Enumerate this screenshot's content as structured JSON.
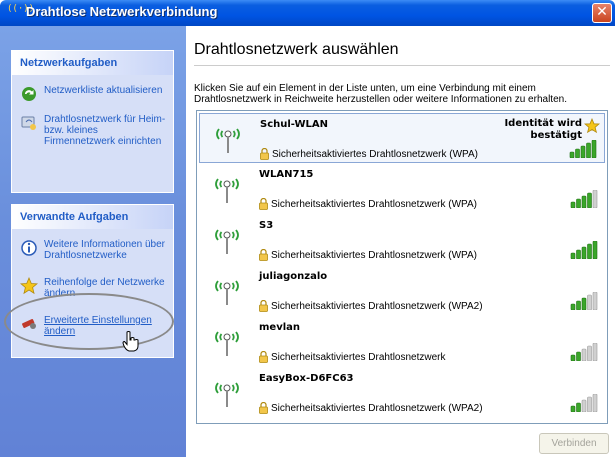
{
  "window": {
    "title": "Drahtlose Netzwerkverbindung",
    "title_icon": "((·))",
    "close_label": "✕"
  },
  "taskpane": {
    "group1": {
      "header": "Netzwerkaufgaben",
      "items": [
        {
          "label": "Netzwerkliste aktualisieren",
          "icon": "refresh-icon"
        },
        {
          "label": "Drahtlosnetzwerk für Heim- bzw. kleines Firmennetzwerk einrichten",
          "icon": "wizard-icon"
        }
      ]
    },
    "group2": {
      "header": "Verwandte Aufgaben",
      "items": [
        {
          "label": "Weitere Informationen über Drahtlosnetzwerke",
          "icon": "info-icon"
        },
        {
          "label": "Reihenfolge der Netzwerke ändern",
          "icon": "star-icon"
        },
        {
          "label": "Erweiterte Einstellungen ändern",
          "icon": "settings-icon"
        }
      ]
    }
  },
  "main": {
    "title": "Drahtlosnetzwerk auswählen",
    "instructions": "Klicken Sie auf ein Element in der Liste unten, um eine Verbindung mit einem Drahtlosnetzwerk in Reichweite herzustellen oder weitere Informationen zu erhalten.",
    "connect_label": "Verbinden"
  },
  "networks": [
    {
      "name": "Schul-WLAN",
      "security": "Sicherheitsaktiviertes Drahtlosnetzwerk (WPA)",
      "status": "Identität wird bestätigt",
      "signal_bars": 5,
      "selected": true
    },
    {
      "name": "WLAN715",
      "security": "Sicherheitsaktiviertes Drahtlosnetzwerk (WPA)",
      "status": "",
      "signal_bars": 4,
      "selected": false
    },
    {
      "name": "S3",
      "security": "Sicherheitsaktiviertes Drahtlosnetzwerk (WPA)",
      "status": "",
      "signal_bars": 5,
      "selected": false
    },
    {
      "name": "juliagonzalo",
      "security": "Sicherheitsaktiviertes Drahtlosnetzwerk (WPA2)",
      "status": "",
      "signal_bars": 3,
      "selected": false
    },
    {
      "name": "mevlan",
      "security": "Sicherheitsaktiviertes Drahtlosnetzwerk",
      "status": "",
      "signal_bars": 2,
      "selected": false
    },
    {
      "name": "EasyBox-D6FC63",
      "security": "Sicherheitsaktiviertes Drahtlosnetzwerk (WPA2)",
      "status": "",
      "signal_bars": 2,
      "selected": false
    }
  ],
  "colors": {
    "signal_on": "#3aa62a",
    "signal_off": "#d0d0d0",
    "link": "#215dc6",
    "antenna": "#2e9e3a"
  }
}
